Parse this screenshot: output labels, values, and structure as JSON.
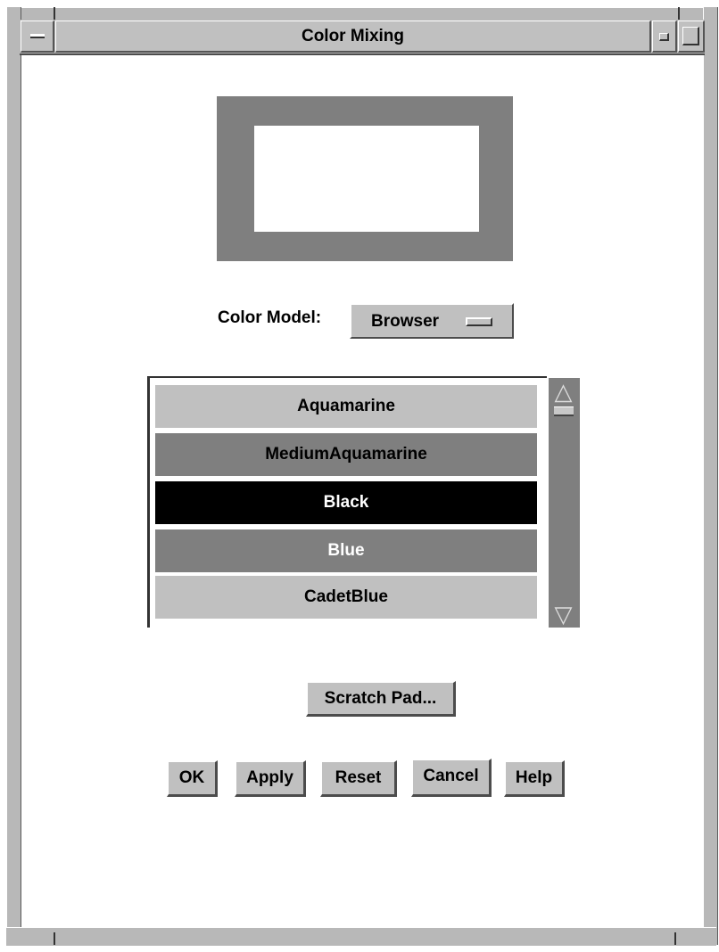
{
  "window": {
    "title": "Color Mixing",
    "menu_icon": "window-menu-icon",
    "minimize_icon": "minimize-icon",
    "maximize_icon": "maximize-icon"
  },
  "preview": {
    "swatch_color": "#ffffff",
    "border_color": "#7f7f7f"
  },
  "color_model": {
    "label": "Color Model:",
    "value": "Browser"
  },
  "color_list": {
    "items": [
      {
        "label": "Aquamarine",
        "bg": "#c0c0c0",
        "fg": "#000000"
      },
      {
        "label": "MediumAquamarine",
        "bg": "#7f7f7f",
        "fg": "#000000"
      },
      {
        "label": "Black",
        "bg": "#000000",
        "fg": "#ffffff"
      },
      {
        "label": "Blue",
        "bg": "#7f7f7f",
        "fg": "#ffffff"
      },
      {
        "label": "CadetBlue",
        "bg": "#c0c0c0",
        "fg": "#000000"
      }
    ],
    "selected": "Black"
  },
  "buttons": {
    "scratch_pad": "Scratch Pad...",
    "ok": "OK",
    "apply": "Apply",
    "reset": "Reset",
    "cancel": "Cancel",
    "help": "Help"
  }
}
